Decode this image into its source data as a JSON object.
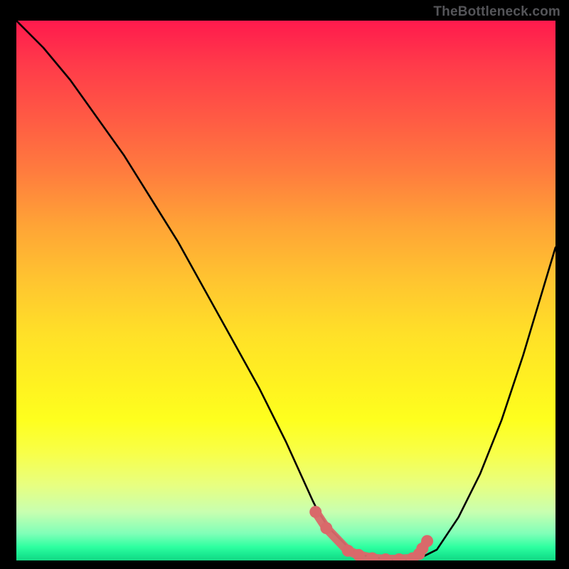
{
  "watermark": "TheBottleneck.com",
  "chart_data": {
    "type": "line",
    "title": "",
    "xlabel": "",
    "ylabel": "",
    "xlim": [
      0,
      100
    ],
    "ylim": [
      0,
      100
    ],
    "series": [
      {
        "name": "bottleneck-curve",
        "x": [
          0,
          5,
          10,
          15,
          20,
          25,
          30,
          35,
          40,
          45,
          50,
          55,
          56,
          58,
          60,
          62,
          64,
          70,
          72,
          74,
          78,
          82,
          86,
          90,
          94,
          100
        ],
        "y": [
          100,
          95,
          89,
          82,
          75,
          67,
          59,
          50,
          41,
          32,
          22,
          11,
          9,
          6,
          4,
          2,
          1,
          0,
          0,
          0,
          2,
          8,
          16,
          26,
          38,
          58
        ]
      }
    ],
    "markers": {
      "name": "highlight-points",
      "color": "#d9696a",
      "x": [
        55.5,
        57.5,
        61.5,
        63.5,
        66,
        68.5,
        71,
        73.5,
        74.7,
        75.3,
        76.2
      ],
      "y": [
        9,
        6,
        1.8,
        1.0,
        0.4,
        0.2,
        0.2,
        0.4,
        1.2,
        2.2,
        3.6
      ]
    },
    "gradient_stops": [
      {
        "pos": 0.0,
        "color": "#ff1a4d"
      },
      {
        "pos": 0.38,
        "color": "#ffa436"
      },
      {
        "pos": 0.68,
        "color": "#fff320"
      },
      {
        "pos": 0.95,
        "color": "#80ffb8"
      },
      {
        "pos": 1.0,
        "color": "#14d884"
      }
    ]
  }
}
